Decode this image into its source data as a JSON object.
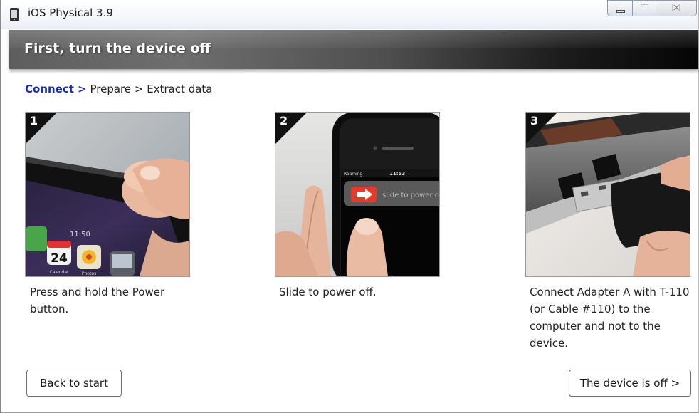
{
  "window": {
    "title": "iOS Physical 3.9",
    "controls": {
      "minimize_icon": "minimize-icon",
      "maximize_icon": "maximize-icon",
      "close_glyph": "☒"
    }
  },
  "header": {
    "title": "First, turn the device off"
  },
  "breadcrumb": {
    "active": "Connect >",
    "rest": "Prepare > Extract data"
  },
  "steps": [
    {
      "number": "1",
      "description": "Press and hold the Power button."
    },
    {
      "number": "2",
      "description": "Slide to power off.",
      "screen": {
        "carrier": "Roaming",
        "time": "11:53",
        "slider_text": "slide to power off"
      }
    },
    {
      "number": "3",
      "description": "Connect Adapter A with T-110 (or Cable #110) to the computer and not to the device."
    }
  ],
  "step1_screen": {
    "time": "11:50",
    "date": "24",
    "calendar_label": "Calendar",
    "photos_label": "Photos"
  },
  "buttons": {
    "back": "Back to start",
    "next": "The device is off >"
  },
  "colors": {
    "breadcrumb_active": "#1b2fa5",
    "slider_arrow": "#e23b2b"
  }
}
